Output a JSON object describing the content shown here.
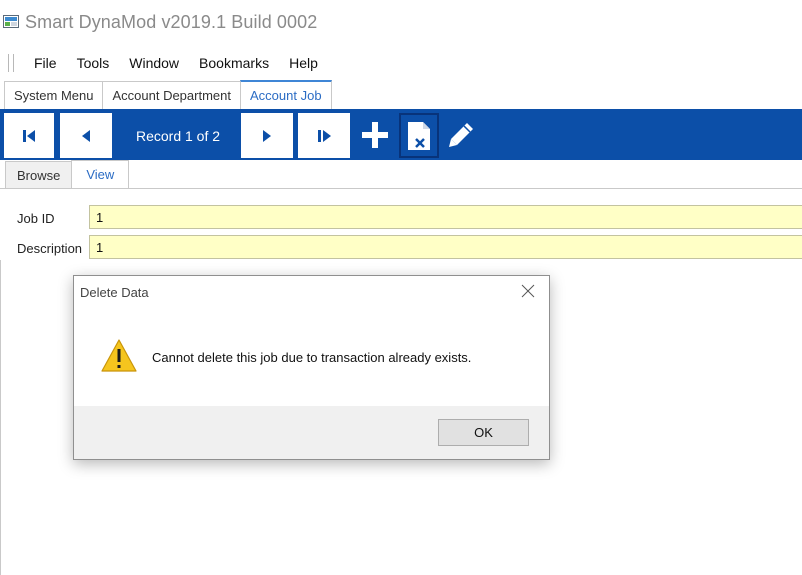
{
  "window": {
    "title": "Smart DynaMod v2019.1 Build 0002"
  },
  "menu": {
    "items": [
      "File",
      "Tools",
      "Window",
      "Bookmarks",
      "Help"
    ]
  },
  "doc_tabs": [
    "System Menu",
    "Account Department",
    "Account Job"
  ],
  "navigator": {
    "record_label": "Record 1 of 2"
  },
  "sub_tabs": [
    "Browse",
    "View"
  ],
  "form": {
    "job_id_label": "Job ID",
    "job_id_value": "1",
    "description_label": "Description",
    "description_value": "1"
  },
  "dialog": {
    "title": "Delete Data",
    "message": "Cannot delete this job due to transaction already exists.",
    "ok_label": "OK"
  },
  "colors": {
    "toolbar_blue": "#0c4fa8",
    "field_yellow": "#ffffc6",
    "active_tab": "#2b6cc4"
  },
  "icons": [
    "app-icon",
    "first-record-icon",
    "previous-record-icon",
    "next-record-icon",
    "last-record-icon",
    "add-icon",
    "delete-icon",
    "edit-icon",
    "close-icon",
    "warning-icon"
  ]
}
